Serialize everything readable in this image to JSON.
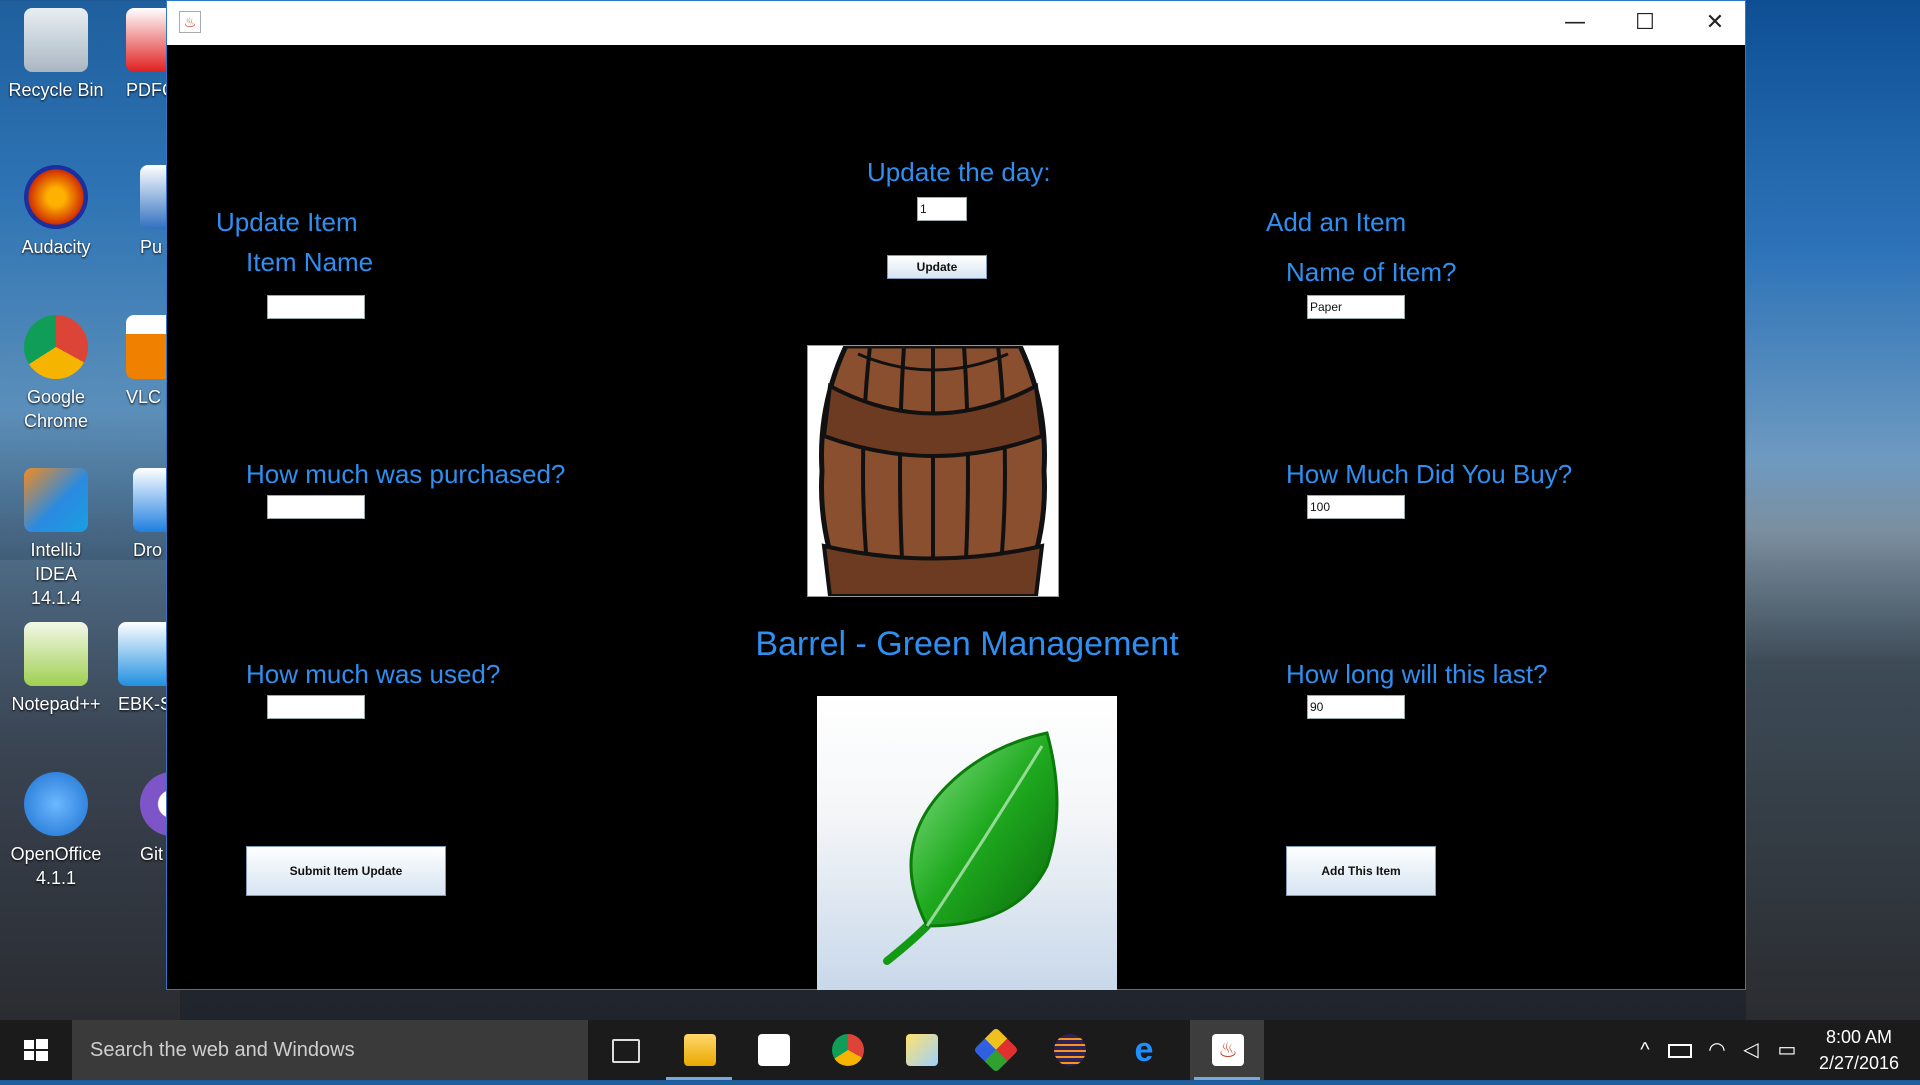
{
  "desktop": {
    "icons": [
      {
        "label": "Recycle Bin",
        "color": "#cfd8e0"
      },
      {
        "label": "Audacity",
        "color": "#f08a00"
      },
      {
        "label": "Google Chrome",
        "color": "#e84436"
      },
      {
        "label": "IntelliJ IDEA 14.1.4",
        "color": "#2b8ae0"
      },
      {
        "label": "Notepad++",
        "color": "#8fc540"
      },
      {
        "label": "OpenOffice 4.1.1",
        "color": "#2d8be6"
      },
      {
        "label": "PDFC",
        "color": "#d02020"
      },
      {
        "label": "Pu",
        "color": "#3070c0"
      },
      {
        "label": "VLC pla",
        "color": "#f08000"
      },
      {
        "label": "Dro",
        "color": "#1f7fe0"
      },
      {
        "label": "EBK-S",
        "color": "#2090e0"
      },
      {
        "label": "Git",
        "color": "#7e55c8"
      }
    ]
  },
  "window": {
    "title": "",
    "controls": {
      "minimize": "—",
      "maximize": "☐",
      "close": "✕"
    }
  },
  "app": {
    "update_day_label": "Update the day:",
    "day_value": "1",
    "update_button": "Update",
    "update_item": {
      "heading": "Update Item",
      "item_name_label": "Item Name",
      "item_name_value": "",
      "purchased_label": "How much was purchased?",
      "purchased_value": "",
      "used_label": "How much was used?",
      "used_value": "",
      "submit_button": "Submit Item Update"
    },
    "add_item": {
      "heading": "Add an Item",
      "name_label": "Name of Item?",
      "name_value": "Paper",
      "buy_label": "How Much Did You Buy?",
      "buy_value": "100",
      "last_label": "How long will this last?",
      "last_value": "90",
      "add_button": "Add This Item"
    },
    "brand_title": "Barrel - Green Management",
    "title_color": "#2f8ff0"
  },
  "taskbar": {
    "search_placeholder": "Search the web and Windows",
    "time": "8:00 AM",
    "date": "2/27/2016",
    "apps": [
      "task-view",
      "file-explorer",
      "store",
      "chrome",
      "photos",
      "paint",
      "eclipse",
      "edge",
      "java"
    ]
  }
}
